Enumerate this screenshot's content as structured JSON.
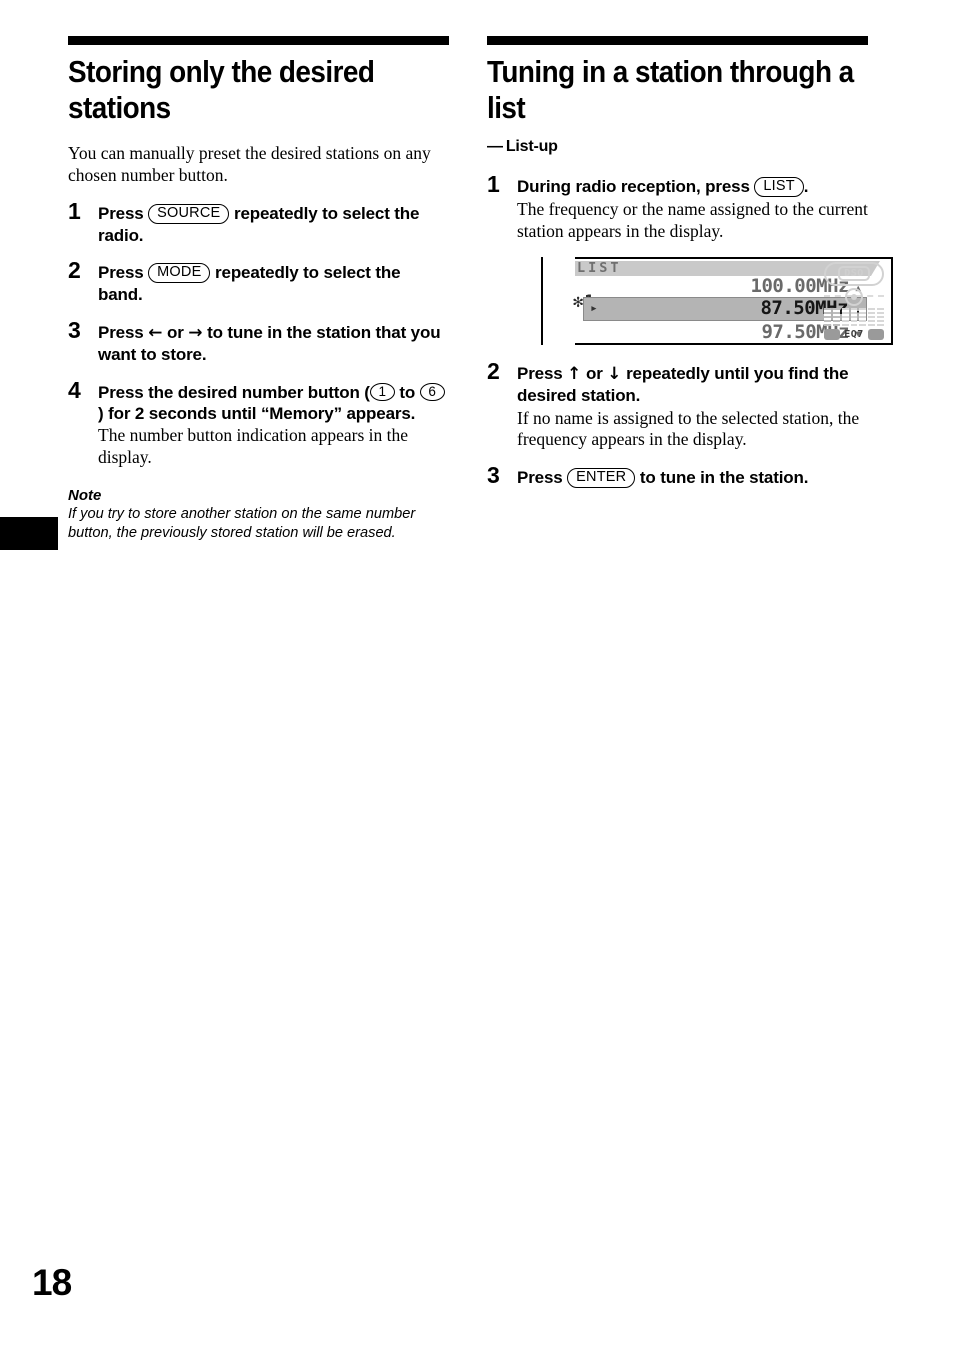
{
  "page": {
    "number": "18"
  },
  "left_column": {
    "title": "Storing only the desired stations",
    "intro": "You can manually preset the desired stations on any chosen number button.",
    "steps": [
      {
        "num": "1",
        "head_pre": "Press",
        "key": "SOURCE",
        "head_post": "repeatedly to select the radio."
      },
      {
        "num": "2",
        "head_pre": "Press",
        "key": "MODE",
        "head_post": "repeatedly to select the band."
      },
      {
        "num": "3",
        "head_pre": "Press",
        "arrow_left": "←",
        "or": "or",
        "arrow_right": "→",
        "head_post": "to tune in the station that you want to store."
      },
      {
        "num": "4",
        "head_pre": "Press the desired number button (",
        "key_first": "1",
        "head_mid": "to",
        "key_last": "6",
        "head_post": ") for 2 seconds until “Memory” appears.",
        "body": "The number button indication appears in the display."
      }
    ],
    "note": {
      "label": "Note",
      "text": "If you try to store another station on the same number button, the previously stored station will be erased."
    }
  },
  "right_column": {
    "title": "Tuning in a station through a list",
    "subtitle_dash": "—",
    "subtitle": "List-up",
    "steps": [
      {
        "num": "1",
        "head_pre": "During radio reception, press",
        "key": "LIST",
        "head_post": ".",
        "body": "The frequency or the name assigned to the current station appears in the display."
      },
      {
        "num": "2",
        "head_pre": "Press",
        "arrow_up": "↑",
        "or": "or",
        "arrow_down": "↓",
        "head_post": "repeatedly until you find the desired station.",
        "body": "If no name is assigned to the selected station, the frequency appears in the display."
      },
      {
        "num": "3",
        "head_pre": "Press",
        "key": "ENTER",
        "head_post": "to tune in the station."
      }
    ],
    "lcd": {
      "mode_label": "LIST",
      "preset_indicator": "✻1",
      "rows": [
        {
          "freq": "100.00MHz",
          "indicator": "▴",
          "selected": false
        },
        {
          "freq": "87.50MHz",
          "indicator": "↵",
          "selected": true,
          "lead_icon": "▸"
        },
        {
          "freq": "97.50MHz",
          "indicator": "▾",
          "selected": false
        }
      ],
      "dso_label": "DSO",
      "eq_label": "EQ7"
    }
  }
}
